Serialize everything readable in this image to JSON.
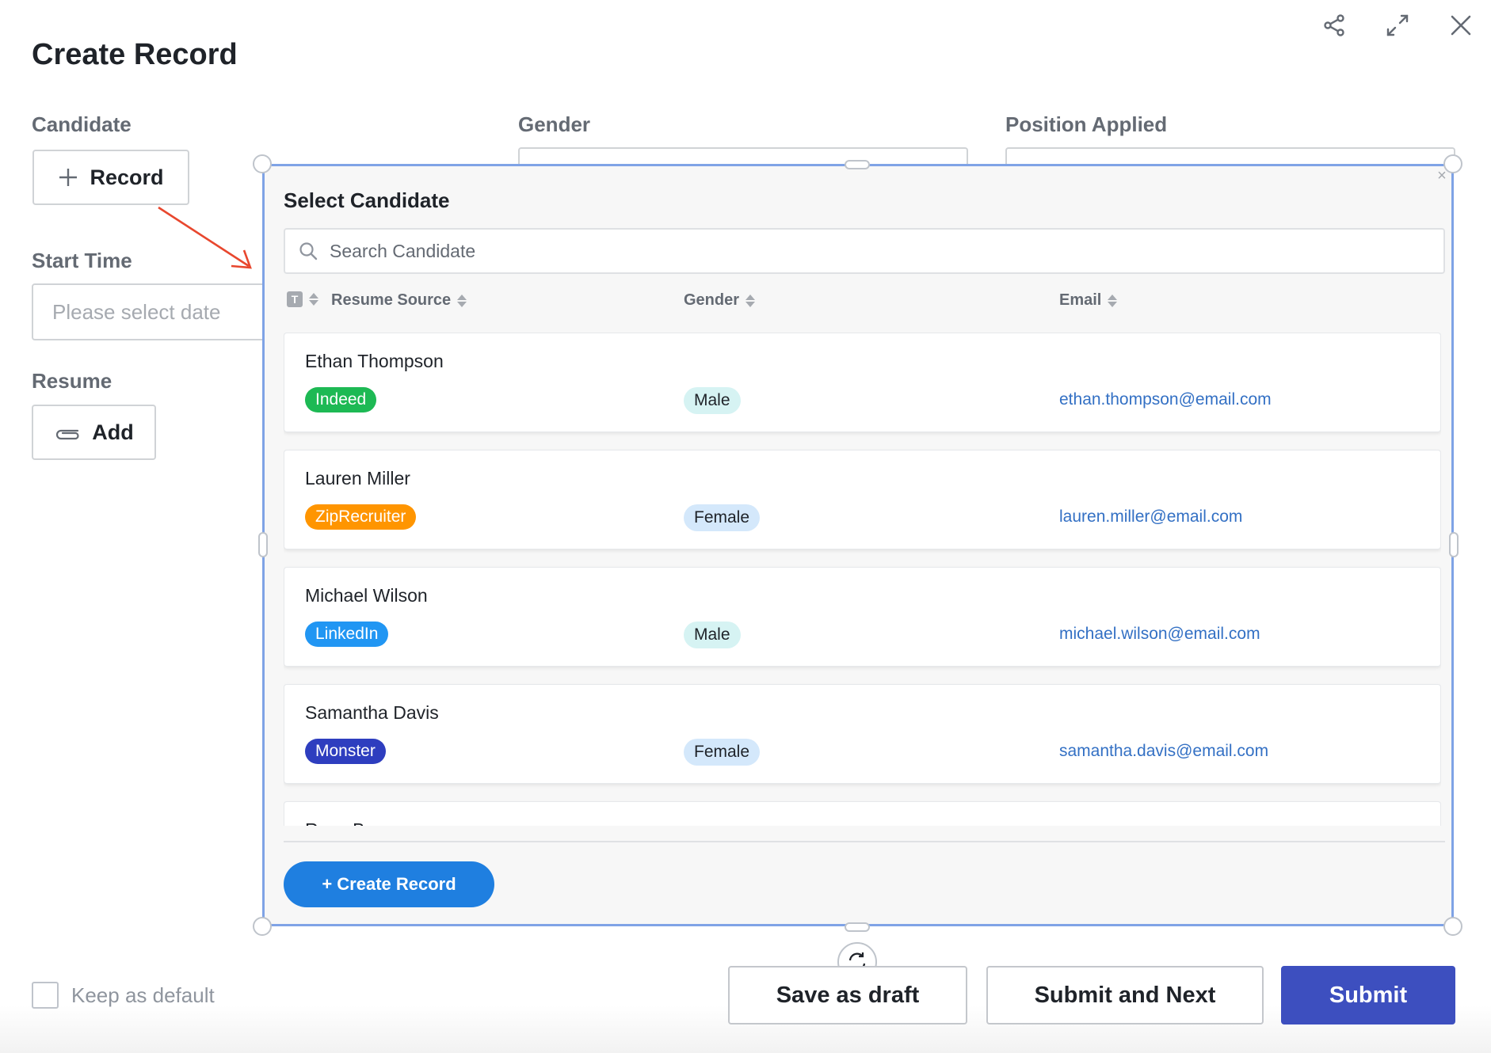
{
  "dialog": {
    "title": "Create Record",
    "icons": {
      "share": "share-icon",
      "expand": "expand-icon",
      "close": "close-icon"
    }
  },
  "form": {
    "candidate_label": "Candidate",
    "record_button": "Record",
    "gender_label": "Gender",
    "position_label": "Position Applied",
    "start_time_label": "Start Time",
    "start_time_placeholder": "Please select date",
    "resume_label": "Resume",
    "add_button": "Add"
  },
  "popup": {
    "title": "Select Candidate",
    "search_placeholder": "Search Candidate",
    "columns": {
      "type_badge": "T",
      "resume_source": "Resume Source",
      "gender": "Gender",
      "email": "Email"
    },
    "candidates": [
      {
        "name": "Ethan Thompson",
        "source": "Indeed",
        "source_color": "#1db954",
        "gender": "Male",
        "gender_color": "#d6f3f3",
        "email": "ethan.thompson@email.com"
      },
      {
        "name": "Lauren Miller",
        "source": "ZipRecruiter",
        "source_color": "#ff9500",
        "gender": "Female",
        "gender_color": "#d4e8fb",
        "email": "lauren.miller@email.com"
      },
      {
        "name": "Michael Wilson",
        "source": "LinkedIn",
        "source_color": "#2196f3",
        "gender": "Male",
        "gender_color": "#d6f3f3",
        "email": "michael.wilson@email.com"
      },
      {
        "name": "Samantha Davis",
        "source": "Monster",
        "source_color": "#2e3ebf",
        "gender": "Female",
        "gender_color": "#d4e8fb",
        "email": "samantha.davis@email.com"
      },
      {
        "name": "Ryan Brown"
      }
    ],
    "create_button": "+ Create Record"
  },
  "footer": {
    "keep_default": "Keep as default",
    "save_draft": "Save as draft",
    "submit_next": "Submit and Next",
    "submit": "Submit"
  },
  "colors": {
    "accent": "#1f7fe0",
    "submit": "#3d4fbf",
    "selection_border": "#7fa3e6",
    "annotation_arrow": "#e8472e",
    "email_link": "#3370c4"
  }
}
